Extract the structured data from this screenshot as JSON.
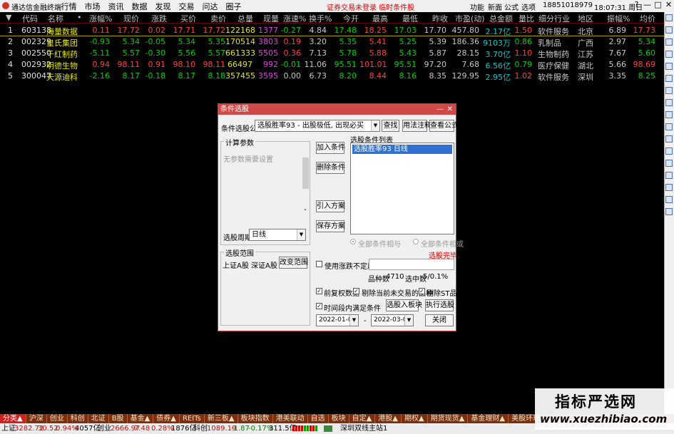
{
  "app": {
    "title": "通达信金融终端"
  },
  "menu": [
    "行情",
    "市场",
    "资讯",
    "数据",
    "发现",
    "交易",
    "问达",
    "圈子"
  ],
  "promo": "证券交易未登录 临时条件股",
  "topright": {
    "func": "功能",
    "news": "新面",
    "formula": "公式",
    "options": "选项",
    "phone": "18851018979",
    "time": "18:07:31 周日"
  },
  "window_buttons": [
    "?",
    "—",
    "□",
    "✕"
  ],
  "table": {
    "headers": [
      "▼",
      "代码",
      "名称",
      "•",
      "涨幅%",
      "现价",
      "涨跌",
      "买价",
      "卖价",
      "总量",
      "现量",
      "涨速%",
      "换手%",
      "今开",
      "最高",
      "最低",
      "昨收",
      "市盈(动)",
      "总金额",
      "量比",
      "细分行业",
      "地区",
      "振幅%",
      "均价"
    ],
    "rows": [
      {
        "idx": "1",
        "code": "603138",
        "name": "海量数据",
        "chg": "0.11",
        "price": "17.72",
        "diff": "0.02",
        "bid": "17.71",
        "ask": "17.72",
        "vol": "122168",
        "cur": "1377",
        "spd": "-0.27",
        "turn": "4.84",
        "open": "17.48",
        "high": "18.25",
        "low": "17.03",
        "prev": "17.70",
        "pe": "457.80",
        "amt": "2.17亿",
        "vr": "1.50",
        "ind": "软件服务",
        "reg": "北京",
        "amp": "6.89",
        "avg": "17.73"
      },
      {
        "idx": "2",
        "code": "002329",
        "name": "皇氏集团",
        "chg": "-0.93",
        "price": "5.34",
        "diff": "-0.05",
        "bid": "5.34",
        "ask": "5.35",
        "vol": "170514",
        "cur": "3803",
        "spd": "0.19",
        "turn": "3.20",
        "open": "5.35",
        "high": "5.41",
        "low": "5.25",
        "prev": "5.39",
        "pe": "186.36",
        "amt": "9103万",
        "vr": "0.86",
        "ind": "乳制品",
        "reg": "广西",
        "amp": "2.97",
        "avg": "5.34"
      },
      {
        "idx": "3",
        "code": "002550",
        "name": "千红制药",
        "chg": "-5.11",
        "price": "5.57",
        "diff": "-0.30",
        "bid": "5.56",
        "ask": "5.57",
        "vol": "661333",
        "cur": "5505",
        "spd": "0.36",
        "turn": "7.13",
        "open": "5.78",
        "high": "5.88",
        "low": "5.43",
        "prev": "5.87",
        "pe": "28.15",
        "amt": "3.70亿",
        "vr": "1.10",
        "ind": "生物制药",
        "reg": "江苏",
        "amp": "7.67",
        "avg": "5.60"
      },
      {
        "idx": "4",
        "code": "002932",
        "name": "明德生物",
        "chg": "0.94",
        "price": "98.11",
        "diff": "0.91",
        "bid": "98.10",
        "ask": "98.11",
        "vol": "66497",
        "cur": "992",
        "spd": "-0.01",
        "turn": "11.06",
        "open": "95.51",
        "high": "101.01",
        "low": "95.51",
        "prev": "97.20",
        "pe": "7.68",
        "amt": "6.56亿",
        "vr": "0.79",
        "ind": "医疗保健",
        "reg": "湖北",
        "amp": "5.66",
        "avg": "98.69"
      },
      {
        "idx": "5",
        "code": "300047",
        "name": "天源迪科",
        "chg": "-2.16",
        "price": "8.17",
        "diff": "-0.18",
        "bid": "8.17",
        "ask": "8.18",
        "vol": "357455",
        "cur": "3595",
        "spd": "0.00",
        "turn": "6.73",
        "open": "8.20",
        "high": "8.44",
        "low": "8.16",
        "prev": "8.35",
        "pe": "129.95",
        "amt": "2.95亿",
        "vr": "1.02",
        "ind": "软件服务",
        "reg": "深圳",
        "amp": "3.35",
        "avg": "8.25"
      }
    ]
  },
  "dialog": {
    "title": "条件选股",
    "formula_label": "条件选股公式",
    "formula_value": "选股胜率93 - 出股极低, 出现必买",
    "find": "查找",
    "usage": "用法注释",
    "view": "查看公式",
    "params_group": "计算参数",
    "no_params": "无参数需要设置",
    "list_label": "选股条件列表",
    "list_item": "选股胜率93  日线",
    "add": "加入条件",
    "del": "删除条件",
    "import": "引入方案",
    "save": "保存方案",
    "period_label": "选股周期:",
    "period_value": "日线",
    "radio_and": "全部条件相与",
    "radio_or": "全部条件相或",
    "done": "选股完毕.",
    "scope_group": "选股范围",
    "scope_value": "上证A股 深证A股",
    "change_scope": "改变范围",
    "use_uncertain": "使用涨跌不定周期",
    "count_label": "品种数",
    "count_value": "4710",
    "hit_label": "选中数",
    "hit_value": "5/0.1%",
    "pre_adjust": "前复权数据",
    "remove_untraded": "剔除当前未交易的品种",
    "remove_st": "剔除ST品种",
    "time_range": "时间段内满足条件",
    "to_block": "选股入板块",
    "execute": "执行选股",
    "date_from": "2022-01-01",
    "date_sep": "-",
    "date_to": "2022-03-03",
    "close": "关闭"
  },
  "tabs": [
    "分类▲",
    "沪深",
    "创业",
    "科创",
    "北证",
    "B股",
    "基金▲",
    "债券▲",
    "REITs",
    "新三板▲",
    "板块指数",
    "港美联动",
    "自选",
    "板块",
    "自定▲",
    "港股▲",
    "期权▲",
    "期货现货▲",
    "基金理财▲",
    "美股环球▲"
  ],
  "status": {
    "sh_label": "上证",
    "sh_val": "3282.72",
    "sh_diff": "30.52",
    "sh_pct": "0.94%",
    "sh_amt": "4057亿",
    "cy_label": "创业",
    "cy_val": "2666.97",
    "cy_diff": "7.48",
    "cy_pct": "0.28%",
    "cy_amt": "1876亿",
    "kc_label": "科创",
    "kc_val": "1089.19",
    "kc_diff": "-1.87",
    "kc_pct": "-0.17%",
    "kc_amt": "311.5亿",
    "server": "深圳双线主站1"
  },
  "watermark": {
    "line1": "指标严选网",
    "line2": "www.xuezhibiao.com"
  },
  "colors": {
    "up": "#ff4040",
    "down": "#00d000",
    "dialog_title": "#d04848",
    "tab_active": "#d02020"
  }
}
